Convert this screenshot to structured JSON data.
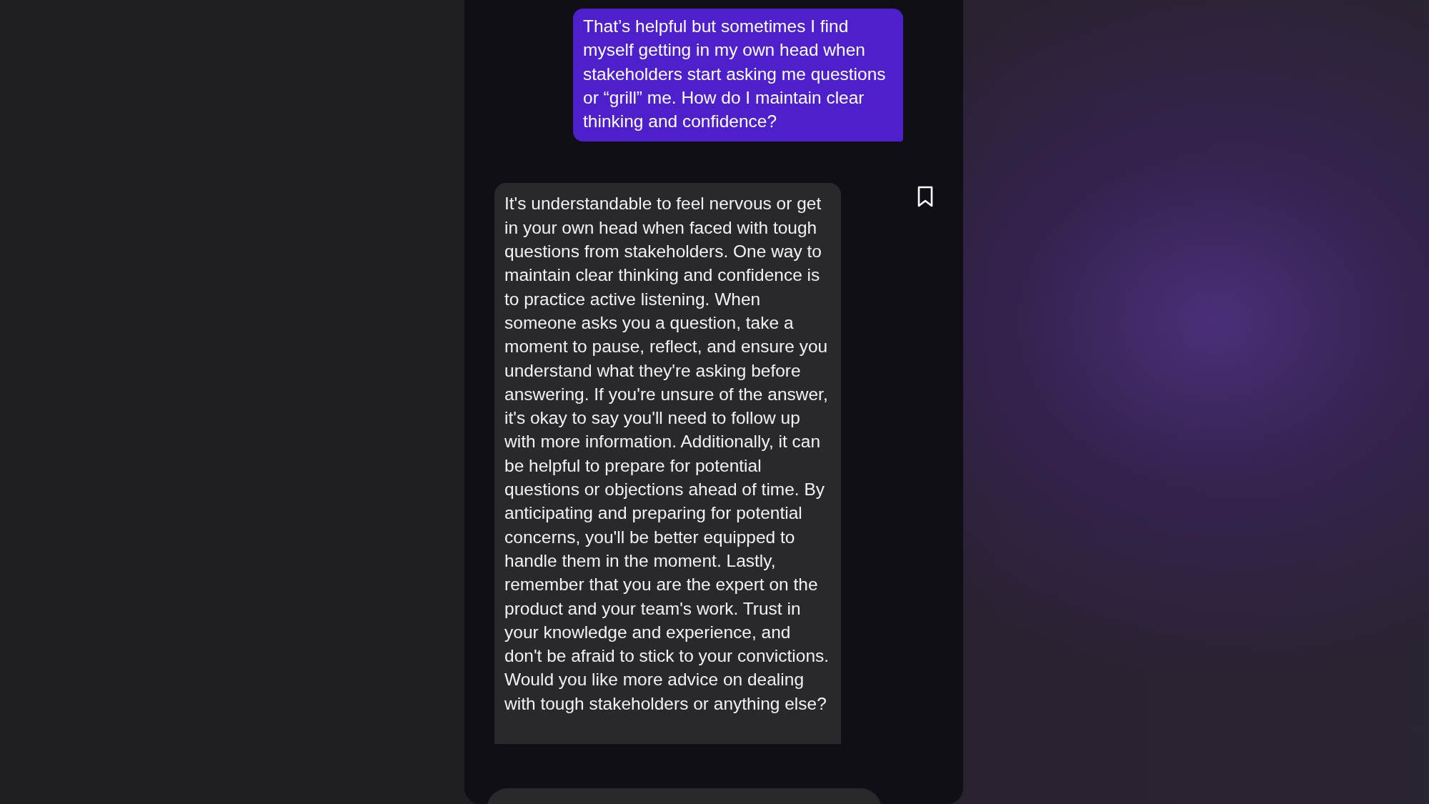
{
  "messages": [
    {
      "kind": "user",
      "text": "That’s helpful but sometimes I find myself getting in my own head when stakeholders start asking me questions or “grill” me. How do I maintain clear thinking and confidence?"
    },
    {
      "kind": "assistant",
      "text": "It's understandable to feel nervous or get in your own head when faced with tough questions from stakeholders. One way to maintain clear thinking and confidence is to practice active listening. When someone asks you a question, take a moment to pause, reflect, and ensure you understand what they're asking before answering. If you're unsure of the answer, it's okay to say you'll need to follow up with more information. Additionally, it can be helpful to prepare for potential questions or objections ahead of time. By anticipating and preparing for potential concerns, you'll be better equipped to handle them in the moment. Lastly, remember that you are the expert on the product and your team's work. Trust in your knowledge and experience, and don't be afraid to stick to your convictions. Would you like more advice on dealing with tough stakeholders or anything else?",
      "bookmarked": false
    }
  ]
}
